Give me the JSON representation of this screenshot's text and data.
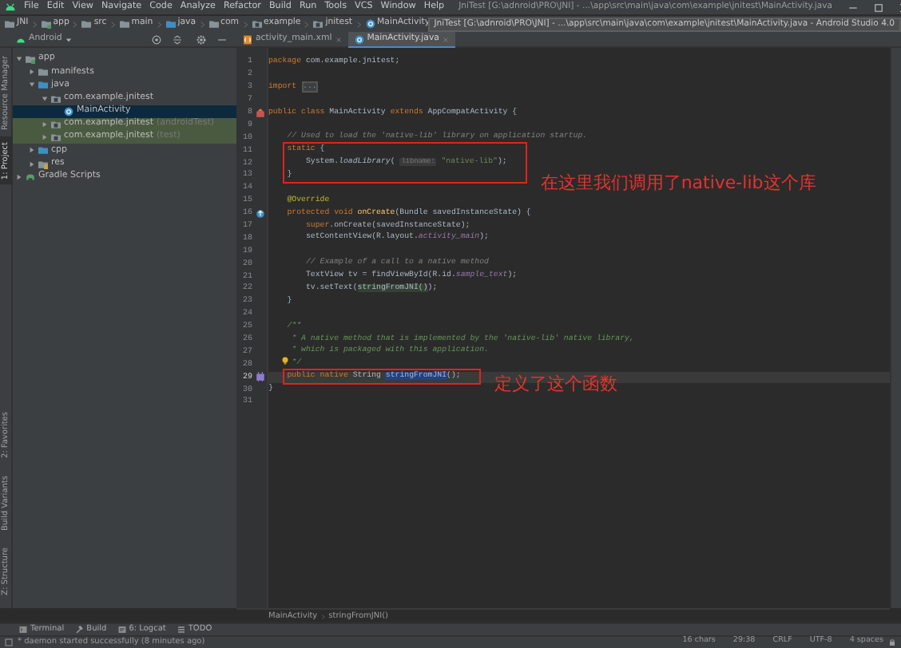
{
  "window": {
    "title": "JniTest [G:\\adnroid\\PRO\\JNI] - ...\\app\\src\\main\\java\\com\\example\\jnitest\\MainActivity.java"
  },
  "menu": [
    "File",
    "Edit",
    "View",
    "Navigate",
    "Code",
    "Analyze",
    "Refactor",
    "Build",
    "Run",
    "Tools",
    "VCS",
    "Window",
    "Help"
  ],
  "nav_bar": [
    {
      "label": "JNI",
      "kind": "folder"
    },
    {
      "label": "app",
      "kind": "module"
    },
    {
      "label": "src",
      "kind": "folder"
    },
    {
      "label": "main",
      "kind": "folder"
    },
    {
      "label": "java",
      "kind": "source"
    },
    {
      "label": "com",
      "kind": "folder"
    },
    {
      "label": "example",
      "kind": "package"
    },
    {
      "label": "jnitest",
      "kind": "package"
    },
    {
      "label": "MainActivity",
      "kind": "class"
    }
  ],
  "tooltip": "JniTest [G:\\adnroid\\PRO\\JNI] - ...\\app\\src\\main\\java\\com\\example\\jnitest\\MainActivity.java - Android Studio 4.0",
  "project_view": {
    "mode": "Android"
  },
  "tabs": [
    {
      "label": "activity_main.xml",
      "kind": "xml",
      "selected": false
    },
    {
      "label": "MainActivity.java",
      "kind": "class",
      "selected": true
    }
  ],
  "left_strip": {
    "top": [
      {
        "label": "Resource Manager",
        "selected": false
      },
      {
        "label": "1: Project",
        "selected": true
      }
    ],
    "bottom": [
      {
        "label": "2: Favorites",
        "selected": false
      },
      {
        "label": "Build Variants",
        "selected": false
      },
      {
        "label": "Z: Structure",
        "selected": false
      }
    ]
  },
  "tree": [
    {
      "label": "app",
      "kind": "module",
      "expanded": true,
      "children": [
        {
          "label": "manifests",
          "kind": "folder",
          "expanded": false
        },
        {
          "label": "java",
          "kind": "source",
          "expanded": true,
          "children": [
            {
              "label": "com.example.jnitest",
              "kind": "package",
              "expanded": true,
              "children": [
                {
                  "label": "MainActivity",
                  "kind": "class",
                  "selected": true
                }
              ]
            },
            {
              "label": "com.example.jnitest",
              "suffix": "(androidTest)",
              "kind": "package",
              "expanded": false,
              "highlighted": true
            },
            {
              "label": "com.example.jnitest",
              "suffix": "(test)",
              "kind": "package",
              "expanded": false,
              "highlighted": true
            }
          ]
        },
        {
          "label": "cpp",
          "kind": "source",
          "expanded": false
        },
        {
          "label": "res",
          "kind": "res",
          "expanded": false
        }
      ]
    },
    {
      "label": "Gradle Scripts",
      "kind": "gradle",
      "expanded": false
    }
  ],
  "code": [
    {
      "number": "1",
      "tokens": [
        {
          "kind": "keyword",
          "text": "package"
        },
        {
          "kind": "plain",
          "text": " com.example.jnitest;"
        }
      ]
    },
    {
      "number": "2"
    },
    {
      "number": "3",
      "tokens": [
        {
          "kind": "keyword",
          "text": "import "
        },
        {
          "kind": "fold",
          "text": "..."
        }
      ]
    },
    {
      "number": "7"
    },
    {
      "number": "8",
      "marker": {
        "kind": "implemented"
      },
      "tokens": [
        {
          "kind": "keyword",
          "text": "public class"
        },
        {
          "kind": "plain",
          "text": " MainActivity "
        },
        {
          "kind": "keyword",
          "text": "extends"
        },
        {
          "kind": "plain",
          "text": " AppCompatActivity {"
        }
      ]
    },
    {
      "number": "9"
    },
    {
      "number": "10",
      "tokens": [
        {
          "kind": "comment",
          "text": "    // Used to load the 'native-lib' library on application startup."
        }
      ]
    },
    {
      "number": "11",
      "boxed": true,
      "tokens": [
        {
          "kind": "keyword",
          "text": "    static"
        },
        {
          "kind": "plain",
          "text": " {"
        }
      ]
    },
    {
      "number": "12",
      "boxed": true,
      "tokens": [
        {
          "kind": "plain",
          "text": "        System."
        },
        {
          "kind": "static",
          "text": "loadLibrary"
        },
        {
          "kind": "plain",
          "text": "( "
        },
        {
          "kind": "hint",
          "text": "libname:"
        },
        {
          "kind": "string",
          "text": " \"native-lib\""
        },
        {
          "kind": "plain",
          "text": ");"
        }
      ]
    },
    {
      "number": "13",
      "boxed": true,
      "callout": "在这里我们调用了native-lib这个库",
      "tokens": [
        {
          "kind": "plain",
          "text": "    }"
        }
      ]
    },
    {
      "number": "14"
    },
    {
      "number": "15",
      "tokens": [
        {
          "kind": "annotation",
          "text": "    @Override"
        }
      ]
    },
    {
      "number": "16",
      "marker": {
        "kind": "override"
      },
      "tokens": [
        {
          "kind": "keyword",
          "text": "    protected void"
        },
        {
          "kind": "method",
          "text": " onCreate"
        },
        {
          "kind": "plain",
          "text": "(Bundle savedInstanceState) {"
        }
      ]
    },
    {
      "number": "17",
      "tokens": [
        {
          "kind": "keyword",
          "text": "        super"
        },
        {
          "kind": "plain",
          "text": ".onCreate(savedInstanceState);"
        }
      ]
    },
    {
      "number": "18",
      "tokens": [
        {
          "kind": "plain",
          "text": "        setContentView(R.layout."
        },
        {
          "kind": "field",
          "text": "activity_main"
        },
        {
          "kind": "plain",
          "text": ");"
        }
      ]
    },
    {
      "number": "19"
    },
    {
      "number": "20",
      "tokens": [
        {
          "kind": "comment",
          "text": "        // Example of a call to a native method"
        }
      ]
    },
    {
      "number": "21",
      "tokens": [
        {
          "kind": "plain",
          "text": "        TextView tv = findViewById(R.id."
        },
        {
          "kind": "field",
          "text": "sample_text"
        },
        {
          "kind": "plain",
          "text": ");"
        }
      ]
    },
    {
      "number": "22",
      "tokens": [
        {
          "kind": "plain",
          "text": "        tv.setText("
        },
        {
          "kind": "call",
          "text": "stringFromJNI()"
        },
        {
          "kind": "plain",
          "text": ");"
        }
      ]
    },
    {
      "number": "23",
      "tokens": [
        {
          "kind": "plain",
          "text": "    }"
        }
      ]
    },
    {
      "number": "24"
    },
    {
      "number": "25",
      "tokens": [
        {
          "kind": "doc",
          "text": "    /**"
        }
      ]
    },
    {
      "number": "26",
      "tokens": [
        {
          "kind": "doc",
          "text": "     * A native method that is implemented by the 'native-lib' native library,"
        }
      ]
    },
    {
      "number": "27",
      "tokens": [
        {
          "kind": "doc",
          "text": "     * which is packaged with this application."
        }
      ]
    },
    {
      "number": "28",
      "bulb": true,
      "tokens": [
        {
          "kind": "doc",
          "text": "     */"
        }
      ]
    },
    {
      "number": "29",
      "marker": {
        "kind": "native"
      },
      "current": true,
      "boxed": true,
      "callout": "定义了这个函数",
      "tokens": [
        {
          "kind": "keyword",
          "text": "    public native"
        },
        {
          "kind": "plain",
          "text": " String "
        },
        {
          "kind": "selected",
          "text": "stringFromJNI"
        },
        {
          "kind": "plain",
          "text": "();"
        }
      ]
    },
    {
      "number": "30",
      "tokens": [
        {
          "kind": "plain",
          "text": "}"
        }
      ]
    },
    {
      "number": "31"
    }
  ],
  "breadcrumb": [
    "MainActivity",
    "stringFromJNI()"
  ],
  "tool_windows": [
    {
      "label": "Terminal",
      "kind": "terminal"
    },
    {
      "label": "Build",
      "kind": "hammer"
    },
    {
      "label": "6: Logcat",
      "kind": "logcat"
    },
    {
      "label": "TODO",
      "kind": "list"
    }
  ],
  "status_bar": {
    "message": "* daemon started successfully (8 minutes ago)",
    "items": [
      "16 chars",
      "29:38",
      "CRLF",
      "UTF-8",
      "4 spaces"
    ]
  }
}
